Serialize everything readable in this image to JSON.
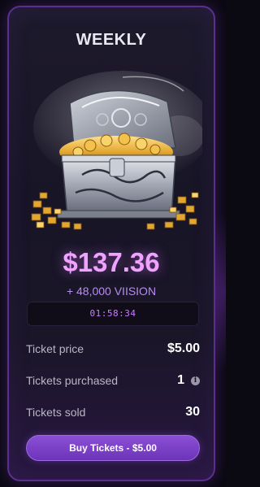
{
  "card": {
    "title": "WEEKLY",
    "prize_amount": "$137.36",
    "bonus": "+ 48,000 VIISION",
    "countdown": "01:58:34",
    "stats": [
      {
        "label": "Ticket price",
        "value": "$5.00"
      },
      {
        "label": "Tickets purchased",
        "value": "1"
      },
      {
        "label": "Tickets sold",
        "value": "30"
      }
    ],
    "buy_button_label": "Buy Tickets - $5.00",
    "image": "treasure-chest",
    "colors": {
      "accent": "#8a4fd6",
      "prize": "#f0a2ff",
      "bonus": "#b78cf0",
      "timer": "#c77dff",
      "border": "#5a2f8e"
    }
  }
}
